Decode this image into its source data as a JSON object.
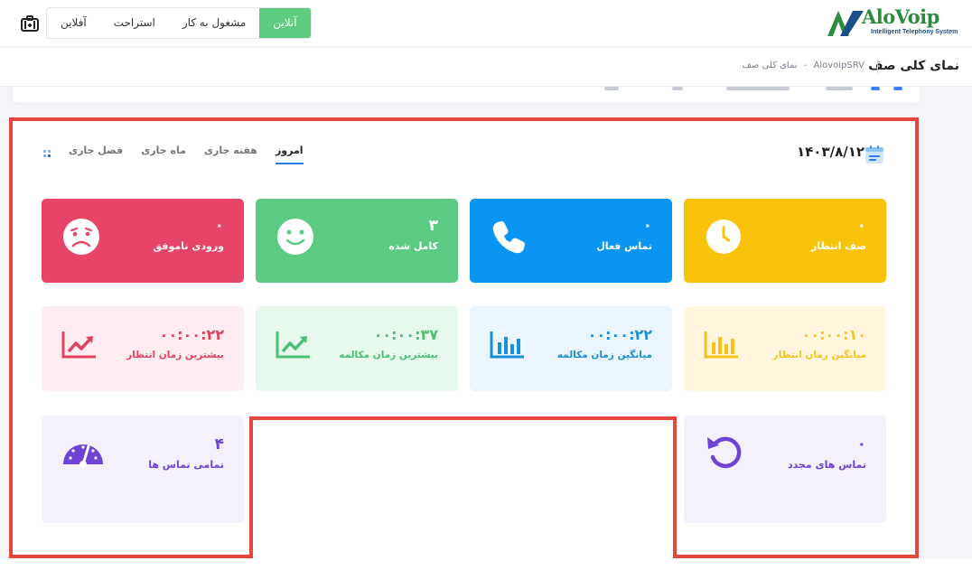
{
  "app": {
    "logo_text": "AloVoip",
    "logo_tagline": "Intelligent Telephony System"
  },
  "status": {
    "options": [
      "آنلاین",
      "مشغول به کار",
      "استراحت",
      "آفلاین"
    ],
    "selected": "آنلاین"
  },
  "header": {
    "page_title": "نمای کلی صف",
    "breadcrumb": [
      "AlovoipSRV",
      "نمای کلی صف"
    ]
  },
  "panel": {
    "date": "۱۴۰۳/۸/۱۲",
    "tabs": [
      "امروز",
      "هفته جاری",
      "ماه جاری",
      "فصل جاری"
    ],
    "active_tab": "امروز"
  },
  "cards": {
    "queue_waiting": {
      "value": "۰",
      "label": "صف انتظار",
      "icon": "clock-icon",
      "color": "#f9c30b"
    },
    "active_calls": {
      "value": "۰",
      "label": "تماس فعال",
      "icon": "phone-icon",
      "color": "#0b95f2"
    },
    "completed": {
      "value": "۳",
      "label": "کامل شده",
      "icon": "smile-icon",
      "color": "#5cca82"
    },
    "failed_incoming": {
      "value": "۰",
      "label": "ورودی ناموفق",
      "icon": "sad-face-icon",
      "color": "#e74468"
    },
    "avg_wait": {
      "value": "۰۰:۰۰:۱۰",
      "label": "میانگین زمان انتظار",
      "icon": "bar-chart-icon",
      "color": "#f8c21c"
    },
    "avg_talk": {
      "value": "۰۰:۰۰:۲۲",
      "label": "میانگین زمان مکالمه",
      "icon": "bar-chart-icon",
      "color": "#1a8fd8"
    },
    "max_talk": {
      "value": "۰۰:۰۰:۳۷",
      "label": "بیشترین زمان مکالمه",
      "icon": "trend-up-icon",
      "color": "#4cbf76"
    },
    "max_wait": {
      "value": "۰۰:۰۰:۲۲",
      "label": "بیشترین زمان انتظار",
      "icon": "trend-up-icon",
      "color": "#e0425f"
    },
    "callbacks": {
      "value": "۰",
      "label": "تماس های مجدد",
      "icon": "undo-icon",
      "color": "#6e43d6"
    },
    "total_calls": {
      "value": "۴",
      "label": "تمامی تماس ها",
      "icon": "speedometer-icon",
      "color": "#6e43d6"
    }
  }
}
